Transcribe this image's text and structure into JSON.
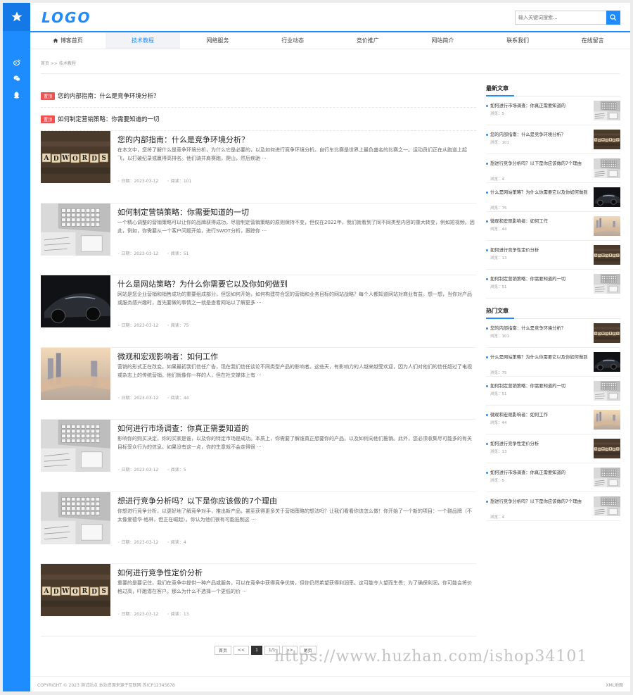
{
  "logo": "LOGO",
  "search": {
    "placeholder": "输入关键词搜索..."
  },
  "nav": [
    {
      "label": "博客首页",
      "active": false
    },
    {
      "label": "技术教程",
      "active": true
    },
    {
      "label": "网络服务",
      "active": false
    },
    {
      "label": "行业动态",
      "active": false
    },
    {
      "label": "竞价推广",
      "active": false
    },
    {
      "label": "网站简介",
      "active": false
    },
    {
      "label": "联系我们",
      "active": false
    },
    {
      "label": "在线留言",
      "active": false
    }
  ],
  "breadcrumb": "首页 >> 技术教程",
  "top_badge": "置顶",
  "top_items": [
    "您的内部指南：什么是竞争环境分析？",
    "如何制定营销策略：你需要知道的一切"
  ],
  "meta_labels": {
    "date": "日期：",
    "views": "阅读："
  },
  "articles": [
    {
      "title": "您的内部指南：什么是竞争环境分析？",
      "desc": "在本文中，您将了解什么是竞争环境分析，为什么它是必要的，以及如何进行竞争环境分析。自行车比赛是世界上最负盛名的比赛之一。运动员们正在从跑道上起飞，以打破纪录或赢得高排名。他们骑并肩赛跑，爬山，然后疾驰 ···",
      "date": "2023-03-12",
      "views": "101",
      "thumb": "adwords"
    },
    {
      "title": "如何制定营销策略：你需要知道的一切",
      "desc": "一个精心调整的营销策略可以让你的品牌获得成功。尽管制定营销策略的原则保持不变，但仅在2022年，我们就看到了同不同类型内容的重大转变，例如短视频。因此，例如，你需要从一个客户问题开始，进行SWOT分析，跟踪你 ···",
      "date": "2023-03-12",
      "views": "51",
      "thumb": "laptop"
    },
    {
      "title": "什么是网站策略？为什么你需要它以及你如何做到",
      "desc": "网站是您企业营销和销售成功的重要组成部分，但您如何开始，如何构建符合您的营销和业务目标的网站战略？每个人都知道网站对商业有益。想一想，当你对产品或服务感兴趣时，首先要做的事情之一就是查看网站以了解更多 ···",
      "date": "2023-03-12",
      "views": "75",
      "thumb": "car"
    },
    {
      "title": "微观和宏观影响者：如何工作",
      "desc": "营销的形式正在改变。如果最初我们信任广告，现在我们信任谈论不同类型产品的影响者。这些天，有影响力的人越来越受欢迎，因为人们对他们的信任超过了电视或杂志上的传统营销。他们就像你一样的人，但在社交媒体上有 ···",
      "date": "2023-03-12",
      "views": "44",
      "thumb": "handshake"
    },
    {
      "title": "如何进行市场调查：你真正需要知道的",
      "desc": "影响你的购买决定，你的买家是谁，以及你的特定市场是成功。本质上，你需要了解谁真正想要你的产品，以及如何向他们推销。此外，您必须收集尽可能多的有关目标受众行为的信息。如果没有这一点，你的生意就不会走得很 ···",
      "date": "2023-03-12",
      "views": "5",
      "thumb": "laptop"
    },
    {
      "title": "想进行竞争分析吗？以下是你应该做的7个理由",
      "desc": "你想进行竞争分析，以更好地了解竞争对手，推出新产品，甚至获得更多关于营销策略的想法吗？让我们看看你该怎么做！你开始了一个新的项目：一个鞋品牌（不太像爱德华·格林，但正在崛起）。你认为他们很有可能抵制这 ···",
      "date": "2023-03-12",
      "views": "4",
      "thumb": "laptop"
    },
    {
      "title": "如何进行竞争性定价分析",
      "desc": "重要的是要记住，我们在竞争中提供一种产品或服务，可以在竞争中获得竞争优势，但你仍然希望获得利润率。这可能令人望而生畏；为了确保利润，你可能会将价格过高，吓跑潜在客户。那么为什么不选择一个更低的价 ···",
      "date": "2023-03-12",
      "views": "13",
      "thumb": "adwords"
    }
  ],
  "pager": [
    "首页",
    "<<",
    "1",
    "1/1",
    ">>",
    "尾页"
  ],
  "footer": {
    "copyright": "COPYRIGHT © 2023 测试站点 本站资源来源于互联网 苏ICP12345678",
    "sitemap": "XML地图"
  },
  "latest": {
    "title": "最新文章",
    "views_label": "浏览：",
    "items": [
      {
        "title": "如何进行市场调查：你真正需要知道的",
        "views": "5",
        "thumb": "laptop"
      },
      {
        "title": "您的内部指南：什么是竞争环境分析？",
        "views": "101",
        "thumb": "adwords"
      },
      {
        "title": "想进行竞争分析吗？以下是你应该做的7个理由",
        "views": "4",
        "thumb": "laptop"
      },
      {
        "title": "什么是网站策略？为什么你需要它以及你如何做到",
        "views": "75",
        "thumb": "car"
      },
      {
        "title": "微观和宏观影响者：如何工作",
        "views": "44",
        "thumb": "handshake"
      },
      {
        "title": "如何进行竞争性定价分析",
        "views": "13",
        "thumb": "adwords"
      },
      {
        "title": "如何制定营销策略：你需要知道的一切",
        "views": "51",
        "thumb": "laptop"
      }
    ]
  },
  "hot": {
    "title": "热门文章",
    "items": [
      {
        "title": "您的内部指南：什么是竞争环境分析？",
        "views": "101",
        "thumb": "adwords"
      },
      {
        "title": "什么是网站策略？为什么你需要它以及你如何做到",
        "views": "75",
        "thumb": "car"
      },
      {
        "title": "如何制定营销策略：你需要知道的一切",
        "views": "51",
        "thumb": "laptop"
      },
      {
        "title": "微观和宏观影响者：如何工作",
        "views": "44",
        "thumb": "handshake"
      },
      {
        "title": "如何进行竞争性定价分析",
        "views": "13",
        "thumb": "adwords"
      },
      {
        "title": "如何进行市场调查：你真正需要知道的",
        "views": "5",
        "thumb": "laptop"
      },
      {
        "title": "想进行竞争分析吗？以下是你应该做的7个理由",
        "views": "4",
        "thumb": "laptop"
      }
    ]
  },
  "watermark": "https://www.huzhan.com/ishop34101",
  "colors": {
    "accent": "#1e8cff",
    "badge": "#f05050"
  }
}
